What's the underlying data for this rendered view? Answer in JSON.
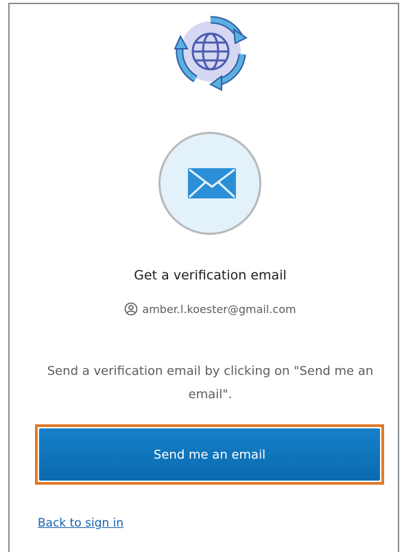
{
  "logo": {
    "icon": "globe-with-cycle-arrows-icon",
    "colors": {
      "arrow": "#5bb0e0",
      "arrow_outline": "#2f5fa8",
      "disc": "#d6d8f3",
      "globe": "#4b5cb0"
    }
  },
  "factor": {
    "icon": "envelope-icon",
    "circle_fill": "#e3f1fb",
    "envelope_color": "#2a8fd6"
  },
  "title": "Get a verification email",
  "identifier": {
    "icon": "user-icon",
    "email": "amber.l.koester@gmail.com"
  },
  "instructions": "Send a verification email by clicking on \"Send me an email\".",
  "send_button": {
    "label": "Send me an email",
    "color": "#0c6aae",
    "highlight_color": "#e07a2c"
  },
  "back_link": "Back to sign in"
}
